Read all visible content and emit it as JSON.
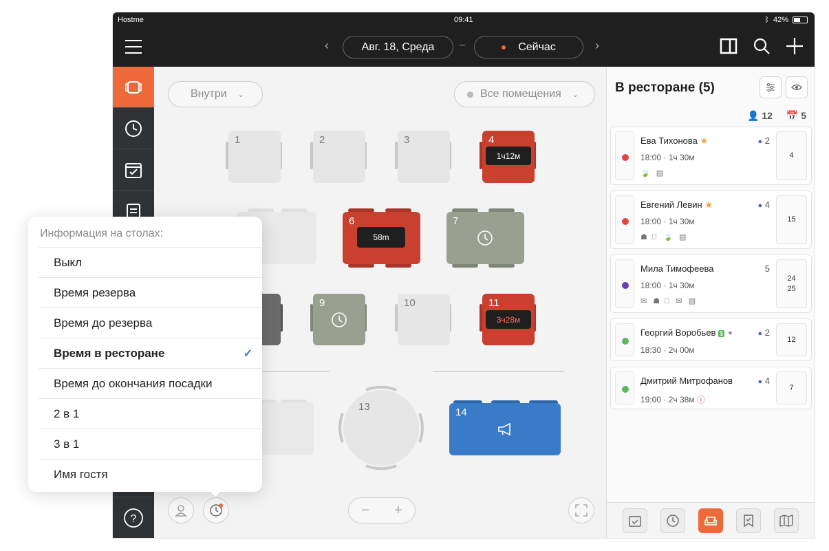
{
  "statusbar": {
    "carrier": "Hostme",
    "time": "09:41",
    "battery": "42%"
  },
  "navbar": {
    "date": "Авг. 18, Среда",
    "now": "Сейчас",
    "dash": "–",
    "prev": "‹",
    "next": "›"
  },
  "floor": {
    "area": "Внутри",
    "rooms": "Все помещения",
    "tables": [
      {
        "num": "1"
      },
      {
        "num": "2"
      },
      {
        "num": "3"
      },
      {
        "num": "4",
        "timer": "1ч12м"
      },
      {
        "num": "6",
        "timer": "58m"
      },
      {
        "num": "7"
      },
      {
        "num": "9"
      },
      {
        "num": "10"
      },
      {
        "num": "11",
        "timer": "3ч28м"
      },
      {
        "num": "13"
      },
      {
        "num": "14"
      }
    ],
    "zoom_minus": "−",
    "zoom_plus": "+"
  },
  "panel": {
    "title": "В ресторане (5)",
    "guests_count": "12",
    "reservations_count": "5",
    "cards": [
      {
        "name": "Ева Тихонова",
        "time": "18:00 · 1ч 30м",
        "party": "2",
        "tables": [
          "4"
        ],
        "dot_color": "#e04848",
        "icons": "🍃 ▤"
      },
      {
        "name": "Евгений Левин",
        "time": "18:00 · 1ч 30м",
        "party": "4",
        "tables": [
          "15"
        ],
        "dot_color": "#e04848",
        "icons": "☗ ⃠ 🍃 ▤"
      },
      {
        "name": "Мила Тимофеева",
        "time": "18:00 · 1ч 30м",
        "party": "5",
        "tables": [
          "24",
          "25"
        ],
        "dot_color": "#6a3fb4",
        "icons": "✉ ☗ ⃠ ✉ ▤"
      },
      {
        "name": "Георгий Воробьев",
        "time": "18:30 · 2ч 00м",
        "party": "2",
        "tables": [
          "12"
        ],
        "dot_color": "#5cb85c",
        "icons": ""
      },
      {
        "name": "Дмитрий Митрофанов",
        "time": "19:00 · 2ч 38м",
        "party": "4",
        "tables": [
          "7"
        ],
        "dot_color": "#5cb85c",
        "icons": ""
      }
    ]
  },
  "popup": {
    "heading": "Информация на столах:",
    "options": [
      "Выкл",
      "Время резерва",
      "Время до резерва",
      "Время в ресторане",
      "Время до окончания посадки",
      "2 в 1",
      "3 в 1",
      "Имя гостя"
    ],
    "selected_index": 3,
    "check": "✓"
  },
  "colors": {
    "accent": "#ee6a3b",
    "occupied": "#c9402f",
    "reserved": "#9aa08f",
    "vip": "#3a7bc8"
  }
}
